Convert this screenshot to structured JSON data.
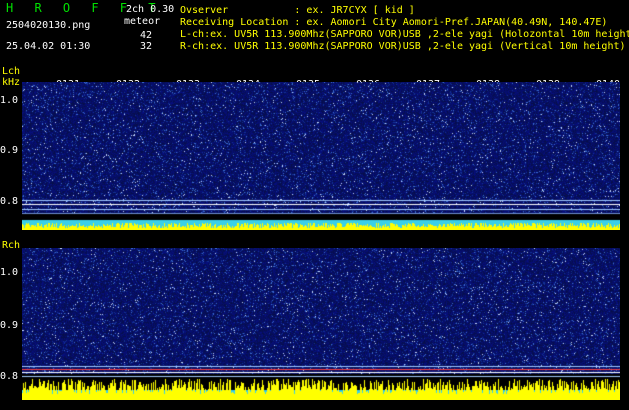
{
  "header": {
    "app_title": "H R O F F T",
    "mode": "2ch 0.30",
    "meteor_label": "meteor",
    "filename": "2504020130.png",
    "datetime": "25.04.02 01:30",
    "count_l": "42",
    "count_r": "32"
  },
  "info": {
    "observer": "Ovserver           : ex. JR7CYX [ kid ]",
    "location": "Receiving Location : ex. Aomori City Aomori-Pref.JAPAN(40.49N, 140.47E)",
    "lch": "L-ch:ex. UV5R 113.900Mhz(SAPPORO VOR)USB ,2-ele yagi (Holozontal 10m height)",
    "rch": "R-ch:ex. UV5R 113.900Mhz(SAPPORO VOR)USB ,2-ele yagi (Vertical 10m height)"
  },
  "lch": {
    "label": "Lch",
    "unit": "kHz",
    "yticks": [
      "1.0",
      "0.9",
      "0.8"
    ]
  },
  "rch": {
    "label": "Rch",
    "yticks": [
      "1.0",
      "0.9",
      "0.8"
    ]
  },
  "xticks": [
    "0131",
    "0132",
    "0133",
    "0134",
    "0135",
    "0136",
    "0137",
    "0138",
    "0139",
    "0140"
  ],
  "colors": {
    "background": "#000000",
    "title": "#00e000",
    "info": "#ffff00",
    "noise": "#0a1a6a",
    "carrier": "#a0c8ff",
    "level": "#ffff00"
  }
}
